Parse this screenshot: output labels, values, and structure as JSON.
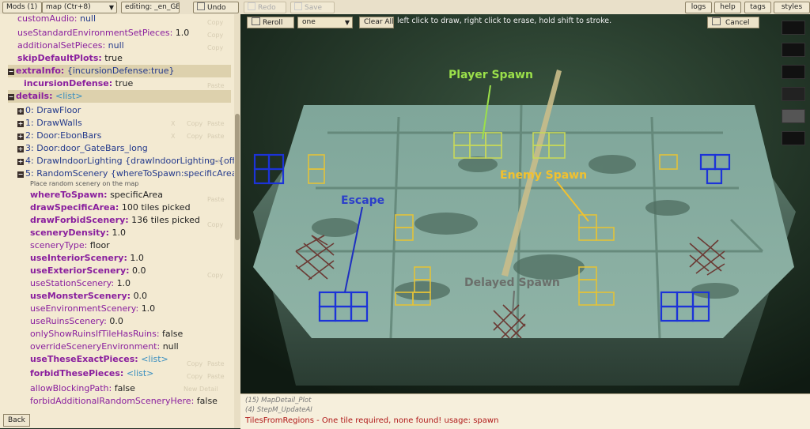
{
  "topbar": {
    "mods": "Mods (1)",
    "map_select": "map (Ctr+8)",
    "editing": "editing: _en_GB",
    "undo": "Undo",
    "redo": "Redo",
    "save": "Save",
    "logs": "logs",
    "help": "help",
    "tags": "tags",
    "styles": "styles"
  },
  "props": {
    "r0": {
      "key": "customAudio:",
      "val": "null"
    },
    "r1": {
      "key": "useStandardEnvironmentSetPieces:",
      "val": "1.0"
    },
    "r2": {
      "key": "additionalSetPieces:",
      "val": "null"
    },
    "r3": {
      "key": "skipDefaultPlots:",
      "val": "true"
    },
    "r4": {
      "key": "extraInfo:",
      "val": "{incursionDefense:true}"
    },
    "r5": {
      "key": "incursionDefense:",
      "val": "true"
    },
    "r6": {
      "key": "details:",
      "val": "<list>"
    },
    "r7": {
      "idx": "0:",
      "val": "DrawFloor"
    },
    "r8": {
      "idx": "1:",
      "val": "DrawWalls"
    },
    "r9": {
      "idx": "2:",
      "val": "Door:EbonBars"
    },
    "r10": {
      "idx": "3:",
      "val": "Door:door_GateBars_long"
    },
    "r11": {
      "idx": "4:",
      "val": "DrawIndoorLighting {drawIndoorLighting-{offset"
    },
    "r12": {
      "idx": "5:",
      "val": "RandomScenery {whereToSpawn:specificArea,dra"
    },
    "tooltip": "Place random scenery on the map",
    "r13": {
      "key": "whereToSpawn:",
      "val": "specificArea"
    },
    "r14": {
      "key": "drawSpecificArea:",
      "val": "100 tiles picked"
    },
    "r15": {
      "key": "drawForbidScenery:",
      "val": "136 tiles picked"
    },
    "r16": {
      "key": "sceneryDensity:",
      "val": "1.0"
    },
    "r17": {
      "key": "sceneryType:",
      "val": "floor"
    },
    "r18": {
      "key": "useInteriorScenery:",
      "val": "1.0"
    },
    "r19": {
      "key": "useExteriorScenery:",
      "val": "0.0"
    },
    "r20": {
      "key": "useStationScenery:",
      "val": "1.0"
    },
    "r21": {
      "key": "useMonsterScenery:",
      "val": "0.0"
    },
    "r22": {
      "key": "useEnvironmentScenery:",
      "val": "1.0"
    },
    "r23": {
      "key": "useRuinsScenery:",
      "val": "0.0"
    },
    "r24": {
      "key": "onlyShowRuinsIfTileHasRuins:",
      "val": "false"
    },
    "r25": {
      "key": "overrideSceneryEnvironment:",
      "val": "null"
    },
    "r26": {
      "key": "useTheseExactPieces:",
      "val": "<list>"
    },
    "r27": {
      "key": "forbidThesePieces:",
      "val": "<list>"
    },
    "r28": {
      "key": "allowBlockingPath:",
      "val": "false"
    },
    "r29": {
      "key": "forbidAdditionalRandomSceneryHere:",
      "val": "false"
    }
  },
  "ghost": {
    "copy": "Copy",
    "paste": "Paste",
    "new_detail": "New Detail",
    "x": "X"
  },
  "back": "Back",
  "view": {
    "reroll": "Reroll",
    "brush": "one",
    "clear_all": "Clear All",
    "hint": "left click to draw, right click to erase, hold shift to stroke.",
    "cancel": "Cancel"
  },
  "labels": {
    "player_spawn": "Player Spawn",
    "enemy_spawn": "Enemy Spawn",
    "escape": "Escape",
    "delayed_spawn": "Delayed Spawn"
  },
  "log": {
    "line1": "(15) MapDetail_Plot",
    "line2": "(4) StepM_UpdateAI",
    "line3": "TilesFromRegions - One tile required, none found! usage: spawn"
  },
  "colors": {
    "key_purple": "#8a1f9e",
    "value_blue": "#243a8c",
    "link_blue": "#3a8fc0",
    "player_label": "#9be04a",
    "enemy_label": "#f2c12e",
    "escape_label": "#2c3fc9",
    "delayed_label": "#6b6f6b",
    "error_red": "#b01818"
  }
}
